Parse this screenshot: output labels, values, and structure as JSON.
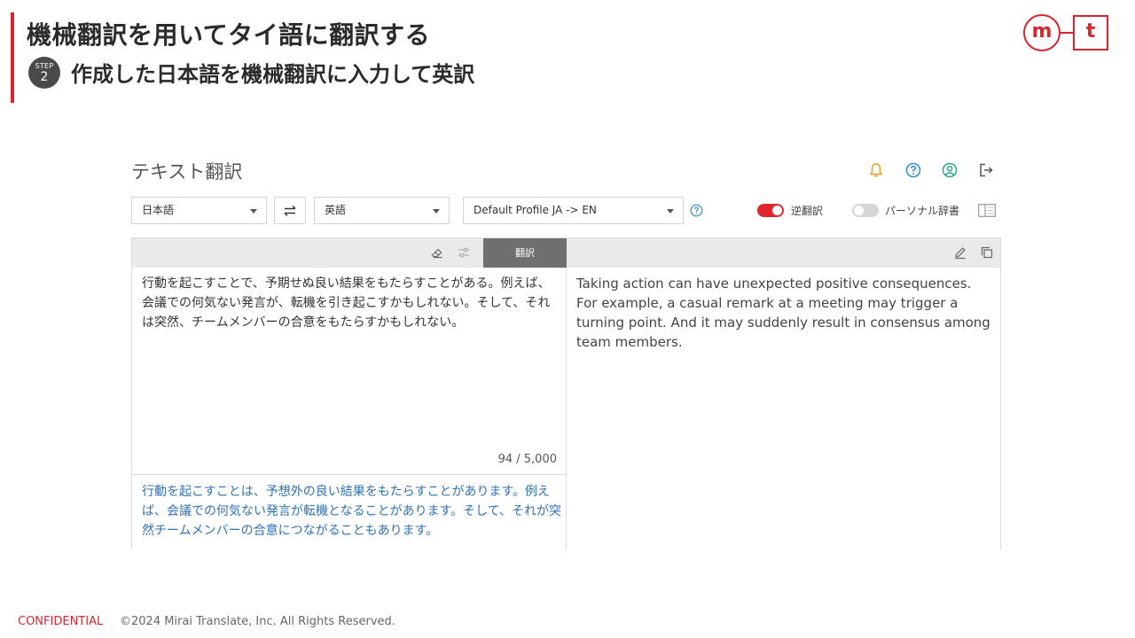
{
  "slide": {
    "title": "機械翻訳を用いてタイ語に翻訳する",
    "step_label": "STEP",
    "step_number": "2",
    "subtitle": "作成した日本語を機械翻訳に入力して英訳",
    "logo_left": "m",
    "logo_right": "t",
    "accent_color": "#d7262f"
  },
  "app": {
    "title": "テキスト翻訳",
    "header_icons": [
      "bell-icon",
      "help-circle-icon",
      "account-icon",
      "logout-icon"
    ],
    "source_language": "日本語",
    "target_language": "英語",
    "profile": "Default Profile JA -> EN",
    "back_translation_toggle": {
      "label": "逆翻訳",
      "on": true,
      "color": "#e0252f"
    },
    "personal_dict_toggle": {
      "label": "パーソナル辞書",
      "on": false
    },
    "translate_button": "翻訳",
    "source_text": "行動を起こすことで、予期せぬ良い結果をもたらすことがある。例えば、会議での何気ない発言が、転機を引き起こすかもしれない。そして、それは突然、チームメンバーの合意をもたらすかもしれない。",
    "char_count": "94 / 5,000",
    "back_translation": "行動を起こすことは、予想外の良い結果をもたらすことがあります。例えば、会議での何気ない発言が転機となることがあります。そして、それが突然チームメンバーの合意につながることもあります。",
    "back_translation_color": "#2f72b5",
    "target_text": "Taking action can have unexpected positive consequences. For example, a casual remark at a meeting may trigger a turning point. And it may suddenly result in consensus among team members."
  },
  "footer": {
    "confidential": "CONFIDENTIAL",
    "copyright": "©2024 Mirai Translate, Inc. All Rights Reserved."
  }
}
